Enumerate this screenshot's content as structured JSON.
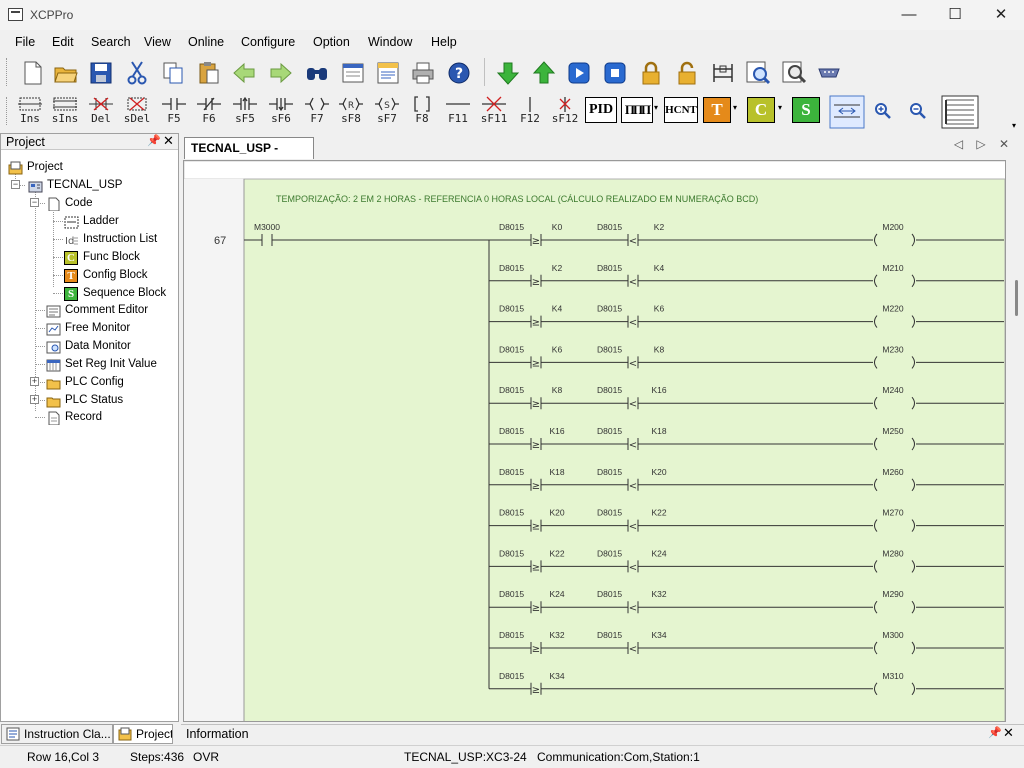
{
  "window": {
    "title": "XCPPro",
    "minimize": "—",
    "maximize": "☐",
    "close": "✕"
  },
  "menu": [
    "File",
    "Edit",
    "Search",
    "View",
    "Online",
    "Configure",
    "Option",
    "Window",
    "Help"
  ],
  "toolbar_main": [
    "new-file-icon",
    "open-folder-icon",
    "save-icon",
    "cut-icon",
    "copy-icon",
    "paste-icon",
    "back-arrow-icon",
    "forward-arrow-icon",
    "find-icon",
    "properties-icon",
    "print-preview-icon",
    "print-icon",
    "help-icon",
    "download-icon",
    "upload-icon",
    "run-icon",
    "stop-icon",
    "lock-icon",
    "unlock-icon",
    "ladder-monitor-icon",
    "zoom-view-icon",
    "search-view-icon",
    "serial-port-icon"
  ],
  "toolbar_ladder": [
    {
      "icon": "insert-icon",
      "label": "Ins"
    },
    {
      "icon": "shift-insert-icon",
      "label": "sIns"
    },
    {
      "icon": "delete-icon",
      "label": "Del"
    },
    {
      "icon": "shift-delete-icon",
      "label": "sDel"
    },
    {
      "icon": "no-contact-icon",
      "label": "F5"
    },
    {
      "icon": "nc-contact-icon",
      "label": "F6"
    },
    {
      "icon": "rising-edge-icon",
      "label": "sF5"
    },
    {
      "icon": "falling-edge-icon",
      "label": "sF6"
    },
    {
      "icon": "coil-icon",
      "label": "F7"
    },
    {
      "icon": "reset-coil-icon",
      "label": "sF8"
    },
    {
      "icon": "set-coil-icon",
      "label": "sF7"
    },
    {
      "icon": "instruction-icon",
      "label": "F8"
    },
    {
      "icon": "horizontal-line-icon",
      "label": "F11"
    },
    {
      "icon": "delete-line-icon",
      "label": "sF11"
    },
    {
      "icon": "vertical-line-icon",
      "label": "F12"
    },
    {
      "icon": "delete-vertical-icon",
      "label": "sF12"
    }
  ],
  "toolbar_special": {
    "pid": "PID",
    "pulse": "ΠΠΠ",
    "hcnt": "HCNT",
    "t": "T",
    "c": "C",
    "s": "S"
  },
  "project_panel": {
    "title": "Project",
    "pin": "📌",
    "close": "✕",
    "tree": [
      {
        "label": "Project",
        "icon": "project-icon"
      },
      {
        "label": "TECNAL_USP",
        "icon": "plc-icon"
      },
      {
        "label": "Code",
        "icon": "code-icon"
      },
      {
        "label": "Ladder",
        "icon": "ladder-icon"
      },
      {
        "label": "Instruction List",
        "icon": "instruction-list-icon"
      },
      {
        "label": "Func Block",
        "icon": "func-block-icon",
        "glyph": "C"
      },
      {
        "label": "Config Block",
        "icon": "config-block-icon",
        "glyph": "T"
      },
      {
        "label": "Sequence Block",
        "icon": "sequence-block-icon",
        "glyph": "S"
      },
      {
        "label": "Comment Editor",
        "icon": "comment-editor-icon"
      },
      {
        "label": "Free Monitor",
        "icon": "free-monitor-icon"
      },
      {
        "label": "Data Monitor",
        "icon": "data-monitor-icon"
      },
      {
        "label": "Set Reg Init Value",
        "icon": "set-reg-icon"
      },
      {
        "label": "PLC Config",
        "icon": "folder-icon"
      },
      {
        "label": "PLC Status",
        "icon": "folder-icon"
      },
      {
        "label": "Record",
        "icon": "record-icon"
      }
    ]
  },
  "bottom_tabs": [
    "Instruction Cla...",
    "Project"
  ],
  "editor": {
    "tab_title": "TECNAL_USP - Ladder",
    "tab_nav": "◁ ▷ ✕",
    "comment": "TEMPORIZAÇÃO: 2 EM 2 HORAS - REFERENCIA 0 HORAS LOCAL (CÁLCULO REALIZADO EM NUMERAÇÃO BCD)",
    "rung_number": "67",
    "input_contact": "M3000",
    "rungs": [
      {
        "reg1": "D8015",
        "k1": "K0",
        "reg2": "D8015",
        "k2": "K2",
        "coil": "M200"
      },
      {
        "reg1": "D8015",
        "k1": "K2",
        "reg2": "D8015",
        "k2": "K4",
        "coil": "M210"
      },
      {
        "reg1": "D8015",
        "k1": "K4",
        "reg2": "D8015",
        "k2": "K6",
        "coil": "M220"
      },
      {
        "reg1": "D8015",
        "k1": "K6",
        "reg2": "D8015",
        "k2": "K8",
        "coil": "M230"
      },
      {
        "reg1": "D8015",
        "k1": "K8",
        "reg2": "D8015",
        "k2": "K16",
        "coil": "M240"
      },
      {
        "reg1": "D8015",
        "k1": "K16",
        "reg2": "D8015",
        "k2": "K18",
        "coil": "M250"
      },
      {
        "reg1": "D8015",
        "k1": "K18",
        "reg2": "D8015",
        "k2": "K20",
        "coil": "M260"
      },
      {
        "reg1": "D8015",
        "k1": "K20",
        "reg2": "D8015",
        "k2": "K22",
        "coil": "M270"
      },
      {
        "reg1": "D8015",
        "k1": "K22",
        "reg2": "D8015",
        "k2": "K24",
        "coil": "M280"
      },
      {
        "reg1": "D8015",
        "k1": "K24",
        "reg2": "D8015",
        "k2": "K32",
        "coil": "M290"
      },
      {
        "reg1": "D8015",
        "k1": "K32",
        "reg2": "D8015",
        "k2": "K34",
        "coil": "M300"
      },
      {
        "reg1": "D8015",
        "k1": "K34",
        "reg2": "",
        "k2": "",
        "coil": "M310"
      }
    ],
    "ge_symbol": "≥",
    "lt_symbol": "<"
  },
  "info_bar": {
    "label": "Information",
    "pin": "📌",
    "close": "✕"
  },
  "status_bar": {
    "position": "Row 16,Col 3",
    "steps": "Steps:436",
    "mode": "OVR",
    "device": "TECNAL_USP:XC3-24",
    "communication": "Communication:Com,Station:1"
  },
  "colors": {
    "ladder_bg": "#e5f5d0",
    "comment": "#3c7a2e",
    "wire": "#333333"
  }
}
